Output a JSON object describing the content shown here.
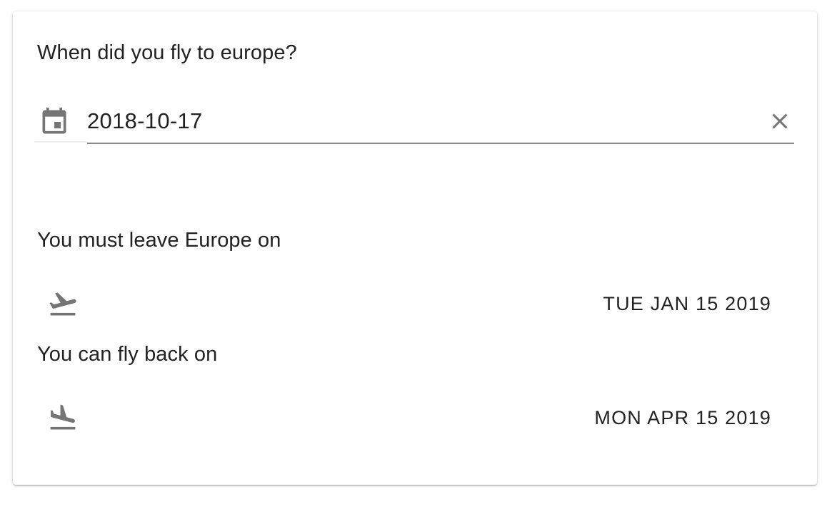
{
  "form": {
    "question": "When did you fly to europe?",
    "date_value": "2018-10-17",
    "icons": {
      "calendar": "calendar-icon",
      "clear": "close-icon"
    }
  },
  "results": {
    "leave_label": "You must leave Europe on",
    "leave_date": "TUE JAN 15 2019",
    "leave_icon": "flight-takeoff-icon",
    "back_label": "You can fly back on",
    "back_date": "MON APR 15 2019",
    "back_icon": "flight-land-icon"
  },
  "colors": {
    "text": "#222222",
    "icon": "#757575",
    "underline": "#8a8a8a"
  }
}
